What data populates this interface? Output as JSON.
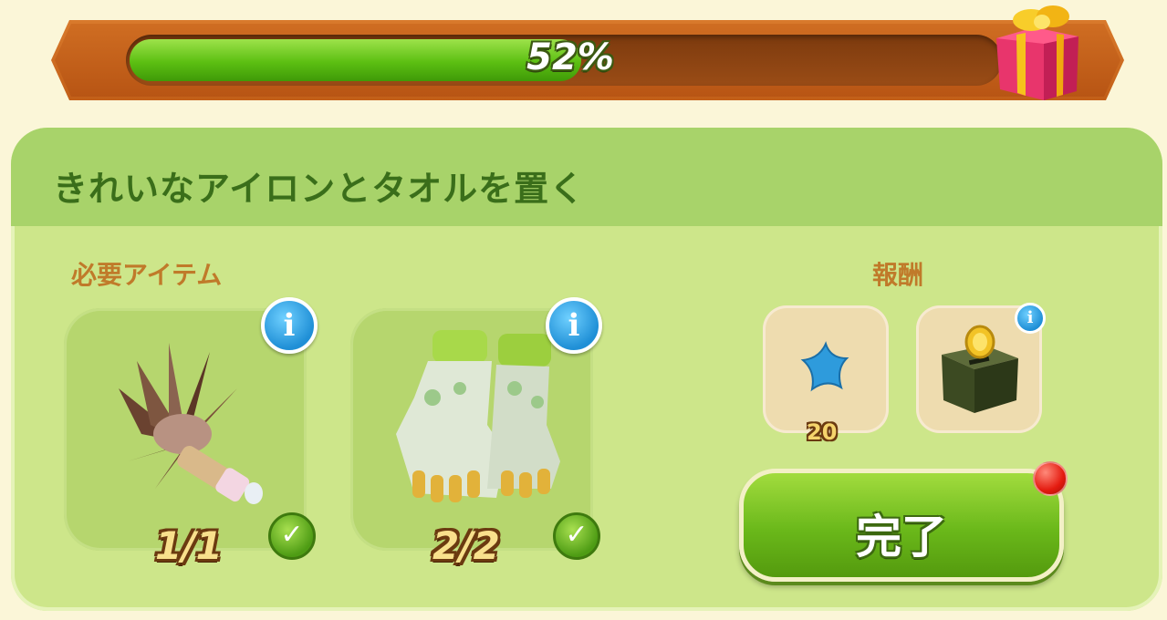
{
  "progress": {
    "value": 0.52,
    "label": "52%"
  },
  "task": {
    "title": "きれいなアイロンとタオルを置く"
  },
  "requirements": {
    "label": "必要アイテム",
    "items": [
      {
        "name": "feather-duster",
        "count": "1/1",
        "complete": true
      },
      {
        "name": "gardening-gloves",
        "count": "2/2",
        "complete": true
      }
    ]
  },
  "rewards": {
    "label": "報酬",
    "items": [
      {
        "name": "blue-star",
        "count": "20"
      },
      {
        "name": "coin-box"
      }
    ]
  },
  "actions": {
    "complete_label": "完了"
  },
  "icons": {
    "info": "i",
    "check": "✓"
  },
  "colors": {
    "accent": "#6ab81a",
    "title": "#3a6e1a",
    "label": "#c07a2a"
  }
}
